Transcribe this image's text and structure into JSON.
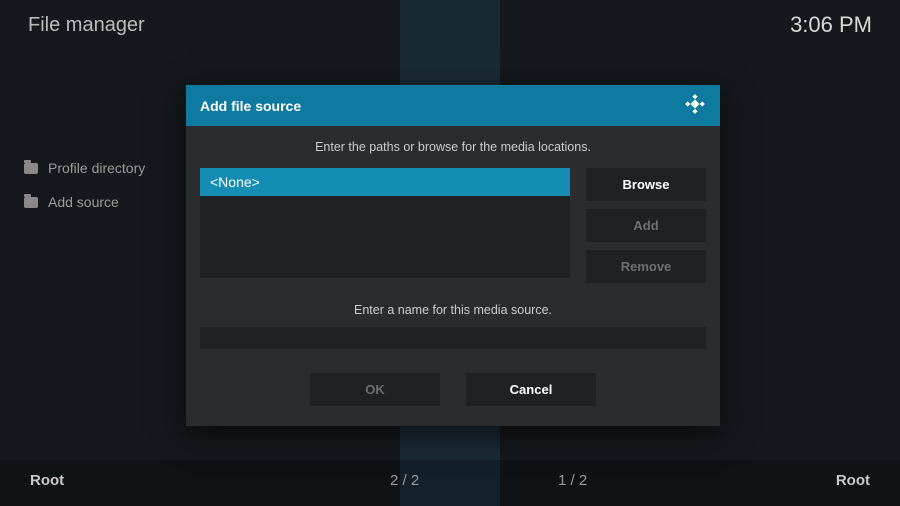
{
  "header": {
    "title": "File manager",
    "clock": "3:06 PM"
  },
  "sidebar": {
    "items": [
      {
        "label": "Profile directory"
      },
      {
        "label": "Add source"
      }
    ]
  },
  "footer": {
    "left_label": "Root",
    "left_count": "2 / 2",
    "right_count": "1 / 2",
    "right_label": "Root"
  },
  "dialog": {
    "title": "Add file source",
    "paths_hint": "Enter the paths or browse for the media locations.",
    "path_value": "<None>",
    "browse": "Browse",
    "add": "Add",
    "remove": "Remove",
    "name_hint": "Enter a name for this media source.",
    "name_value": "",
    "ok": "OK",
    "cancel": "Cancel"
  }
}
